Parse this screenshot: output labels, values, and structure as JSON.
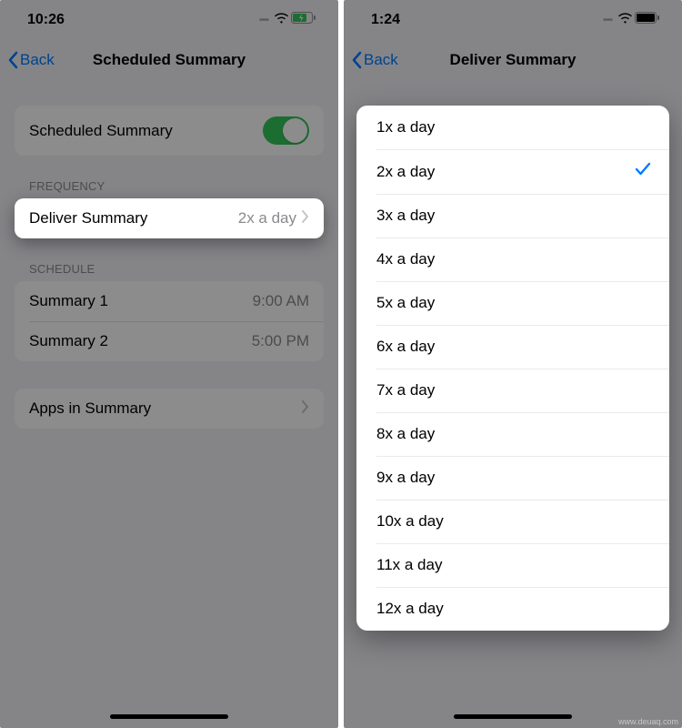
{
  "left": {
    "status": {
      "time": "10:26"
    },
    "nav": {
      "back": "Back",
      "title": "Scheduled Summary"
    },
    "toggle": {
      "label": "Scheduled Summary"
    },
    "frequency": {
      "header": "FREQUENCY",
      "deliver_label": "Deliver Summary",
      "deliver_value": "2x a day"
    },
    "schedule": {
      "header": "SCHEDULE",
      "items": [
        {
          "label": "Summary 1",
          "time": "9:00 AM"
        },
        {
          "label": "Summary 2",
          "time": "5:00 PM"
        }
      ]
    },
    "apps": {
      "label": "Apps in Summary"
    }
  },
  "right": {
    "status": {
      "time": "1:24"
    },
    "nav": {
      "back": "Back",
      "title": "Deliver Summary"
    },
    "options": [
      "1x a day",
      "2x a day",
      "3x a day",
      "4x a day",
      "5x a day",
      "6x a day",
      "7x a day",
      "8x a day",
      "9x a day",
      "10x a day",
      "11x a day",
      "12x a day"
    ],
    "selected": "2x a day"
  },
  "watermark": "www.deuaq.com"
}
